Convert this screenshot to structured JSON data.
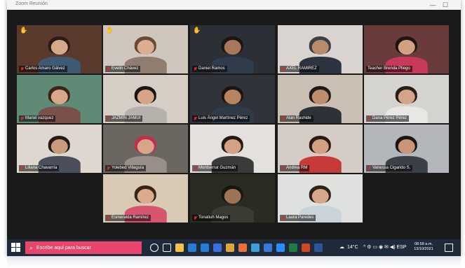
{
  "window": {
    "title": "Zoom Reunión",
    "minimize_glyph": "—",
    "maximize_glyph": "☐"
  },
  "participants": [
    {
      "name": "Carlos Amaro Gálvez",
      "hand_raised": true,
      "muted": true,
      "bg": "#5b3a2e",
      "skin": "#d7a98b",
      "hair": "#2b1b14",
      "shirt": "#3c5a74"
    },
    {
      "name": "Evelin Chávez",
      "hand_raised": true,
      "muted": true,
      "bg": "#cfc7bd",
      "skin": "#d9ae93",
      "hair": "#6b4a32",
      "shirt": "#8f7e6f"
    },
    {
      "name": "Daniel Ramos",
      "hand_raised": true,
      "muted": true,
      "bg": "#2b2f36",
      "skin": "#a9785b",
      "hair": "#1d1612",
      "shirt": "#2f3c4c"
    },
    {
      "name": "AXEL RAMIREZ",
      "hand_raised": false,
      "muted": true,
      "bg": "#d9d4cf",
      "skin": "#b98a6b",
      "hair": "#3a3f47",
      "shirt": "#2d3440"
    },
    {
      "name": "Teacher Brenda Pliego",
      "hand_raised": false,
      "muted": false,
      "active": true,
      "bg": "#6a3b3b",
      "skin": "#d2a184",
      "hair": "#1f1512",
      "shirt": "#c83a5a"
    },
    {
      "name": "Mariel vazquez",
      "hand_raised": false,
      "muted": true,
      "bg": "#5f8a76",
      "skin": "#d8a88c",
      "hair": "#3a2418",
      "shirt": "#7a5148"
    },
    {
      "name": "JAZMÍN JAMUI",
      "hand_raised": false,
      "muted": true,
      "bg": "#d6cec5",
      "skin": "#d6a488",
      "hair": "#1c1411",
      "shirt": "#b7b1ab"
    },
    {
      "name": "Luis Ángel Martínez Pérez",
      "hand_raised": false,
      "muted": true,
      "bg": "#30343a",
      "skin": "#b6855f",
      "hair": "#1b1410",
      "shirt": "#2f3b46"
    },
    {
      "name": "Alan Rashide",
      "hand_raised": false,
      "muted": true,
      "bg": "#c9bfb3",
      "skin": "#c08d6c",
      "hair": "#1e1a18",
      "shirt": "#2d3138"
    },
    {
      "name": "Dana Pérez Pérez",
      "hand_raised": false,
      "muted": true,
      "bg": "#d5d3cf",
      "skin": "#d3a48a",
      "hair": "#2a1c15",
      "shirt": "#e9e7e3"
    },
    {
      "name": "Liliana Chavarría",
      "hand_raised": false,
      "muted": true,
      "bg": "#ddd7cf",
      "skin": "#c99a7c",
      "hair": "#241915",
      "shirt": "#4a4f5b"
    },
    {
      "name": "Yolebed Villaguía",
      "hand_raised": false,
      "muted": true,
      "bg": "#6c6661",
      "skin": "#d6a58a",
      "hair": "#c0304e",
      "shirt": "#9a8f88"
    },
    {
      "name": "Montserrat Guzmán",
      "hand_raised": false,
      "muted": true,
      "bg": "#e4e0dc",
      "skin": "#d4a184",
      "hair": "#231815",
      "shirt": "#3a3a3a"
    },
    {
      "name": "Andrea RM",
      "hand_raised": false,
      "muted": true,
      "bg": "#d5cdc5",
      "skin": "#d3a084",
      "hair": "#2a1914",
      "shirt": "#c63a3a"
    },
    {
      "name": "Vanessa Cigarido S.",
      "hand_raised": false,
      "muted": true,
      "bg": "#b3b7bc",
      "skin": "#c89678",
      "hair": "#1c1512",
      "shirt": "#3b3f46"
    },
    {
      "name": "Esmeralda Ramírez",
      "hand_raised": false,
      "muted": true,
      "bg": "#d9cab6",
      "skin": "#dcaa8c",
      "hair": "#3a2418",
      "shirt": "#d7566f"
    },
    {
      "name": "Tonatiuh Magos",
      "hand_raised": false,
      "muted": true,
      "bg": "#2a2b23",
      "skin": "#9e7356",
      "hair": "#1a1510",
      "shirt": "#3a3c33"
    },
    {
      "name": "Laura Paredes",
      "hand_raised": false,
      "muted": true,
      "bg": "#dfe1de",
      "skin": "#d5a88c",
      "hair": "#2d211b",
      "shirt": "#c9d3da"
    }
  ],
  "taskbar": {
    "search_placeholder": "Escribe aquí para buscar",
    "search_icon": "search-icon",
    "app_icons": [
      {
        "name": "cortana-icon",
        "color": "#ffffff"
      },
      {
        "name": "task-view-icon",
        "color": "#ffffff"
      },
      {
        "name": "file-explorer-icon",
        "color": "#f2c24b"
      },
      {
        "name": "store-icon",
        "color": "#2a7bd6"
      },
      {
        "name": "mail-icon",
        "color": "#2a7bd6"
      },
      {
        "name": "dropbox-icon",
        "color": "#3a6fe0"
      },
      {
        "name": "chrome-icon",
        "color": "#e0a63a"
      },
      {
        "name": "firefox-icon",
        "color": "#e8723a"
      },
      {
        "name": "edge-icon",
        "color": "#3aa0d6"
      },
      {
        "name": "calendar-icon",
        "color": "#3a78d6"
      },
      {
        "name": "zoom-icon",
        "color": "#2d8cff"
      },
      {
        "name": "excel-icon",
        "color": "#1f7a44"
      },
      {
        "name": "powerpoint-icon",
        "color": "#d24726"
      },
      {
        "name": "word-icon",
        "color": "#2b5797"
      }
    ],
    "weather": "14°C",
    "tray_glyphs": "^ ⚙ ▭ ◉ ✉ ◀) ESP",
    "time": "08:58 a.m.",
    "date": "13/10/2021",
    "notification_icon": "notification-icon"
  }
}
